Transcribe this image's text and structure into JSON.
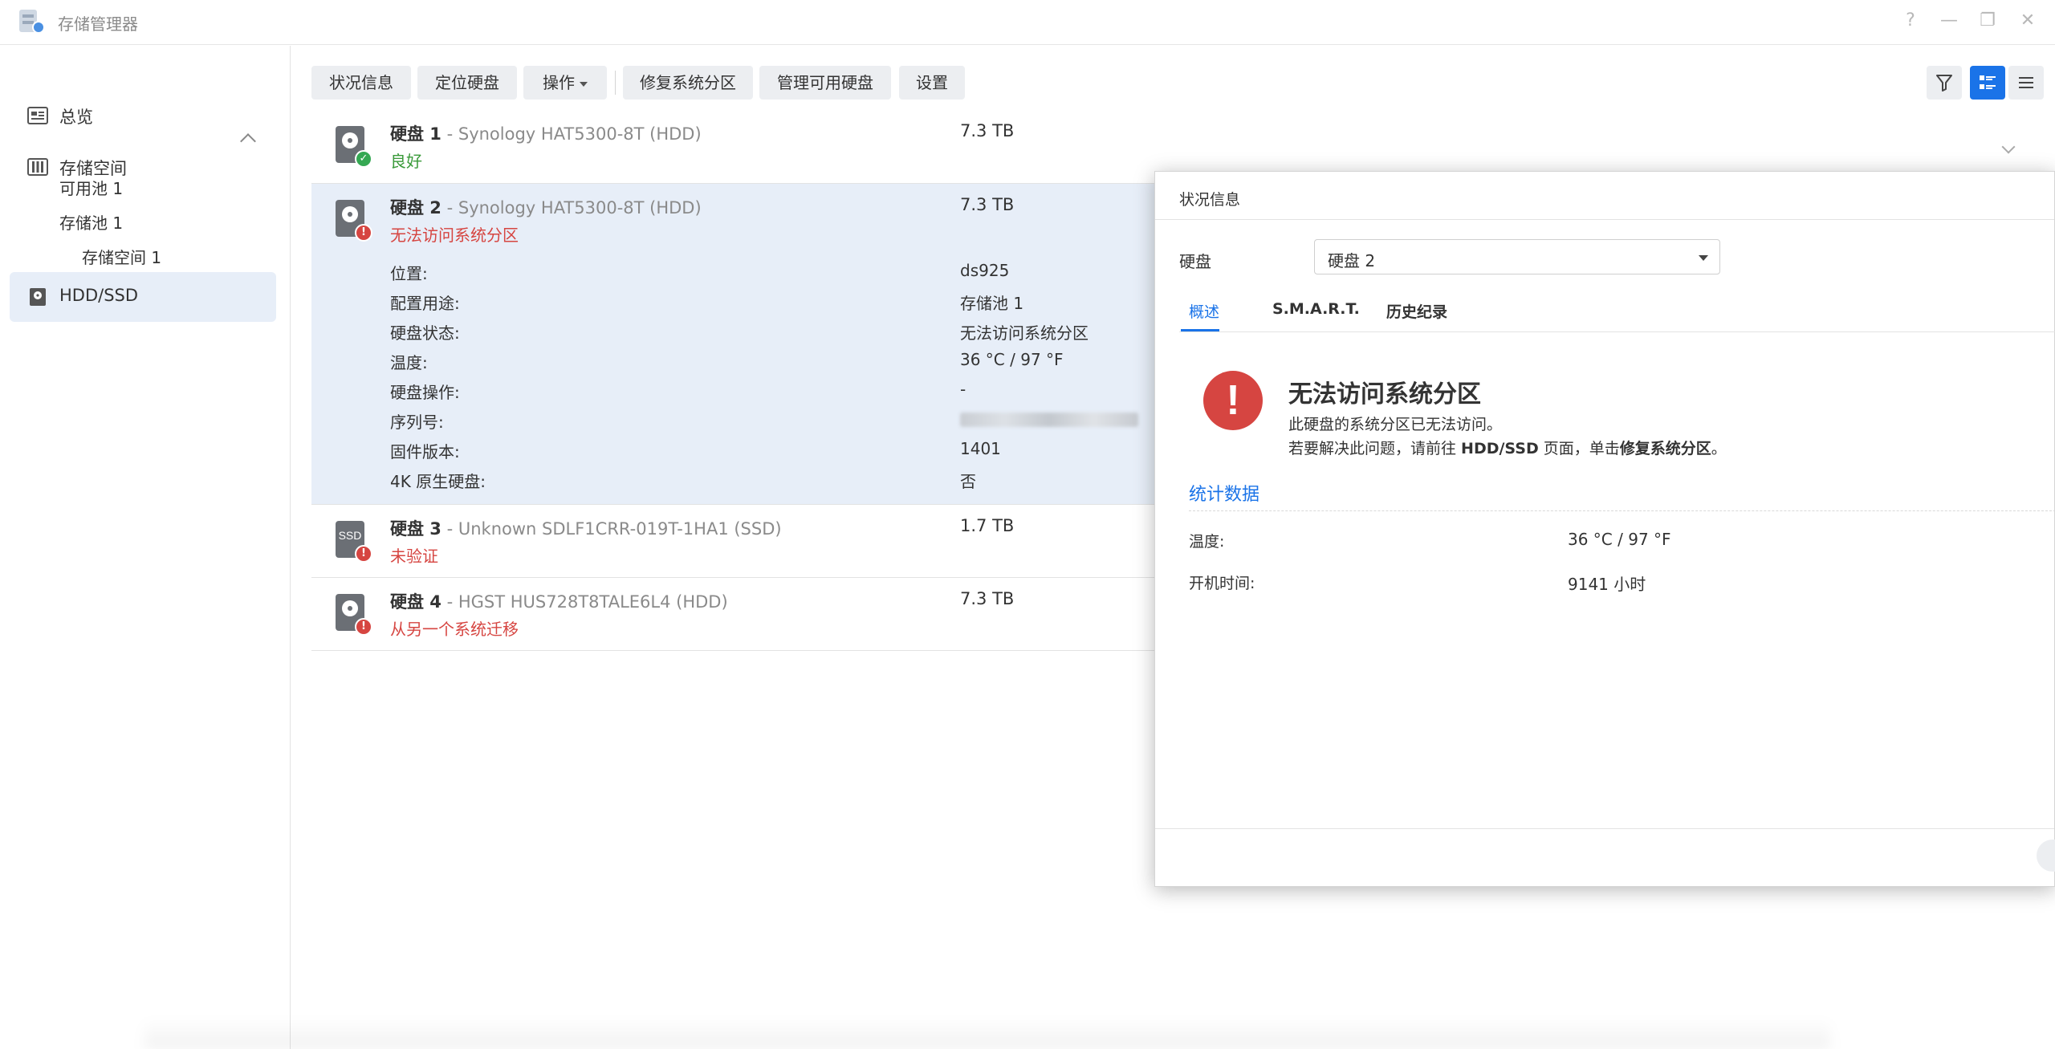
{
  "window": {
    "title": "存储管理器",
    "controls": [
      "?",
      "—",
      "❐",
      "✕"
    ]
  },
  "sidebar": {
    "overview": "总览",
    "storage": "存储空间",
    "sub": [
      "可用池 1",
      "存储池 1",
      "存储空间 1"
    ],
    "hddssd": "HDD/SSD"
  },
  "toolbar": {
    "status_info": "状况信息",
    "locate": "定位硬盘",
    "action": "操作",
    "repair": "修复系统分区",
    "manage": "管理可用硬盘",
    "settings": "设置"
  },
  "disks": [
    {
      "label": "硬盘 1",
      "model": " - Synology HAT5300-8T (HDD)",
      "status": "良好",
      "size": "7.3 TB"
    },
    {
      "label": "硬盘 2",
      "model": " - Synology HAT5300-8T (HDD)",
      "status": "无法访问系统分区",
      "size": "7.3 TB"
    },
    {
      "label": "硬盘 3",
      "model": " - Unknown SDLF1CRR-019T-1HA1 (SSD)",
      "status": "未验证",
      "size": "1.7 TB"
    },
    {
      "label": "硬盘 4",
      "model": " - HGST HUS728T8TALE6L4 (HDD)",
      "status": "从另一个系统迁移",
      "size": "7.3 TB"
    }
  ],
  "details": {
    "labels": [
      "位置:",
      "配置用途:",
      "硬盘状态:",
      "温度:",
      "硬盘操作:",
      "序列号:",
      "固件版本:",
      "4K 原生硬盘:"
    ],
    "values": [
      "ds925",
      "存储池 1",
      "无法访问系统分区",
      "36 °C / 97 °F",
      "-",
      "",
      "1401",
      "否"
    ]
  },
  "dialog": {
    "title": "状况信息",
    "disk_label": "硬盘",
    "disk_selected": "硬盘 2",
    "tabs": [
      "概述",
      "S.M.A.R.T.",
      "历史纪录"
    ],
    "alert_title": "无法访问系统分区",
    "alert_line1": "此硬盘的系统分区已无法访问。",
    "alert_line2_a": "若要解决此问题，请前往 ",
    "alert_line2_b": "HDD/SSD",
    "alert_line2_c": " 页面，单击",
    "alert_line2_d": "修复系统分区",
    "alert_line2_e": "。",
    "section": "统计数据",
    "stats": [
      {
        "label": "温度:",
        "value": "36 °C / 97 °F"
      },
      {
        "label": "开机时间:",
        "value": "9141 小时"
      }
    ]
  },
  "colors": {
    "accent": "#1a73e8",
    "error": "#d64541",
    "good": "#3a9a3a",
    "selected_row": "#e7eef8"
  },
  "icons": [
    "app-icon",
    "overview-icon",
    "storage-icon",
    "hdd-icon",
    "ssd-icon",
    "filter-icon",
    "detail-view-icon",
    "list-view-icon",
    "help-icon",
    "minimize-icon",
    "restore-icon",
    "close-icon"
  ]
}
